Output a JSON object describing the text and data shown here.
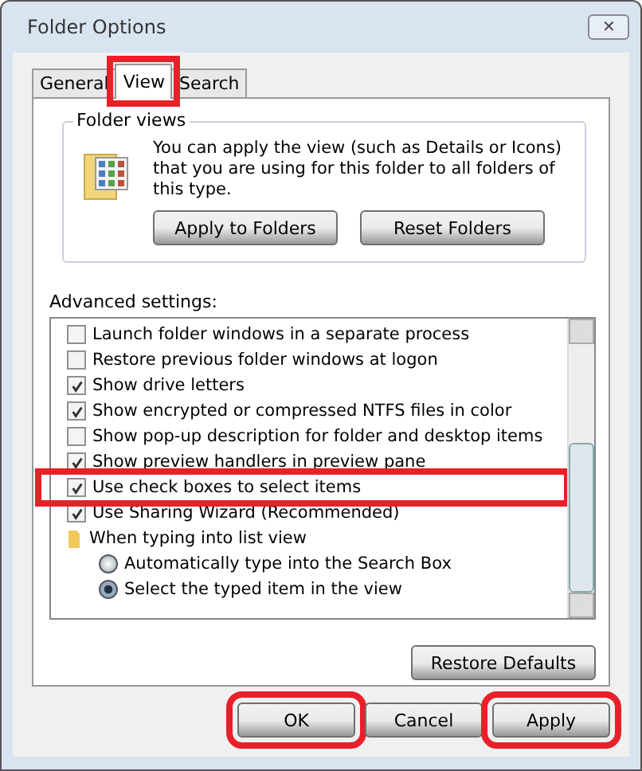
{
  "window": {
    "title": "Folder Options",
    "close": "✕"
  },
  "tabs": [
    {
      "label": "General",
      "selected": false,
      "highlighted": false
    },
    {
      "label": "View",
      "selected": true,
      "highlighted": true
    },
    {
      "label": "Search",
      "selected": false,
      "highlighted": false
    }
  ],
  "folder_views": {
    "title": "Folder views",
    "description": "You can apply the view (such as Details or Icons) that you are using for this folder to all folders of this type.",
    "buttons": [
      "Apply to Folders",
      "Reset Folders"
    ]
  },
  "advanced": {
    "label": "Advanced settings:",
    "items": [
      {
        "kind": "checkbox",
        "label": "Launch folder windows in a separate process",
        "checked": false,
        "highlighted": false
      },
      {
        "kind": "checkbox",
        "label": "Restore previous folder windows at logon",
        "checked": false,
        "highlighted": false
      },
      {
        "kind": "checkbox",
        "label": "Show drive letters",
        "checked": true,
        "highlighted": false
      },
      {
        "kind": "checkbox",
        "label": "Show encrypted or compressed NTFS files in color",
        "checked": true,
        "highlighted": false
      },
      {
        "kind": "checkbox",
        "label": "Show pop-up description for folder and desktop items",
        "checked": false,
        "highlighted": false
      },
      {
        "kind": "checkbox",
        "label": "Show preview handlers in preview pane",
        "checked": true,
        "highlighted": false
      },
      {
        "kind": "checkbox",
        "label": "Use check boxes to select items",
        "checked": true,
        "highlighted": true
      },
      {
        "kind": "checkbox",
        "label": "Use Sharing Wizard (Recommended)",
        "checked": true,
        "highlighted": false
      },
      {
        "kind": "folder",
        "label": "When typing into list view",
        "children": [
          {
            "kind": "radio",
            "label": "Automatically type into the Search Box",
            "selected": false
          },
          {
            "kind": "radio",
            "label": "Select the typed item in the view",
            "selected": true
          }
        ]
      }
    ],
    "restore_button": "Restore Defaults"
  },
  "buttons": [
    {
      "label": "OK",
      "highlighted": true
    },
    {
      "label": "Cancel",
      "highlighted": false
    },
    {
      "label": "Apply",
      "highlighted": true
    }
  ]
}
